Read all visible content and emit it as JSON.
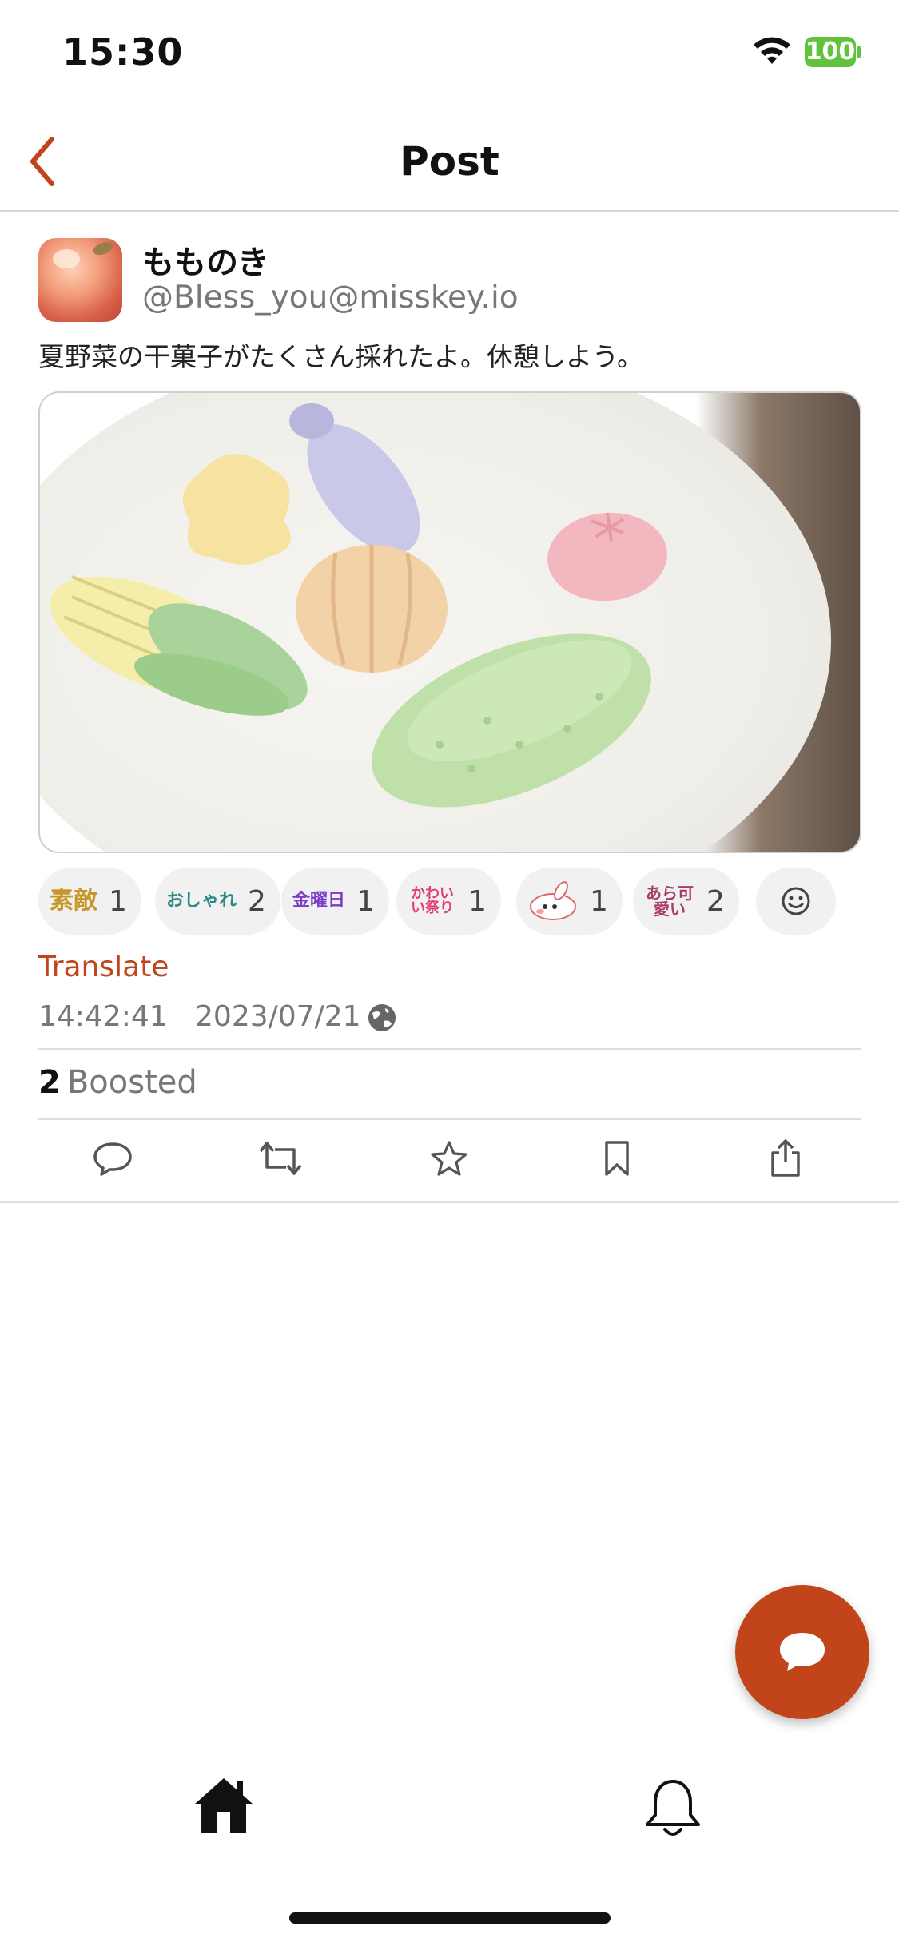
{
  "status_bar": {
    "time": "15:30",
    "battery": "100",
    "icons": [
      "wifi-icon",
      "battery-icon"
    ]
  },
  "nav": {
    "title": "Post",
    "back_icon": "chevron-left-icon"
  },
  "post": {
    "display_name": "もものき",
    "username": "@Bless_you@misskey.io",
    "text": "夏野菜の干菓子がたくさん採れたよ。休憩しよう。",
    "media_alt": "vegetable-shaped sweets on a white plate",
    "reactions": [
      {
        "emoji_text": "素敵",
        "count": "1",
        "color": "#c8962a"
      },
      {
        "emoji_text": "おしゃれ",
        "count": "2",
        "color": "#2a8a8a"
      },
      {
        "emoji_text": "金曜日",
        "count": "1",
        "color": "#7a3cc8"
      },
      {
        "emoji_text": "かわいい祭り",
        "count": "1",
        "color": "#e0407a"
      },
      {
        "emoji_text": "",
        "count": "1",
        "color": "#e67a7a"
      },
      {
        "emoji_text": "あら可愛い",
        "count": "2",
        "color": "#a83c6a"
      }
    ],
    "translate_label": "Translate",
    "time": "14:42:41",
    "date": "2023/07/21",
    "boost_count": "2",
    "boost_label": "Boosted"
  },
  "actions": [
    "reply-icon",
    "renote-icon",
    "favorite-icon",
    "bookmark-icon",
    "share-icon"
  ],
  "colors": {
    "accent": "#c1441b",
    "text_secondary": "#777777",
    "divider": "#dedede"
  },
  "tabs": [
    "home-icon",
    "bell-icon"
  ]
}
